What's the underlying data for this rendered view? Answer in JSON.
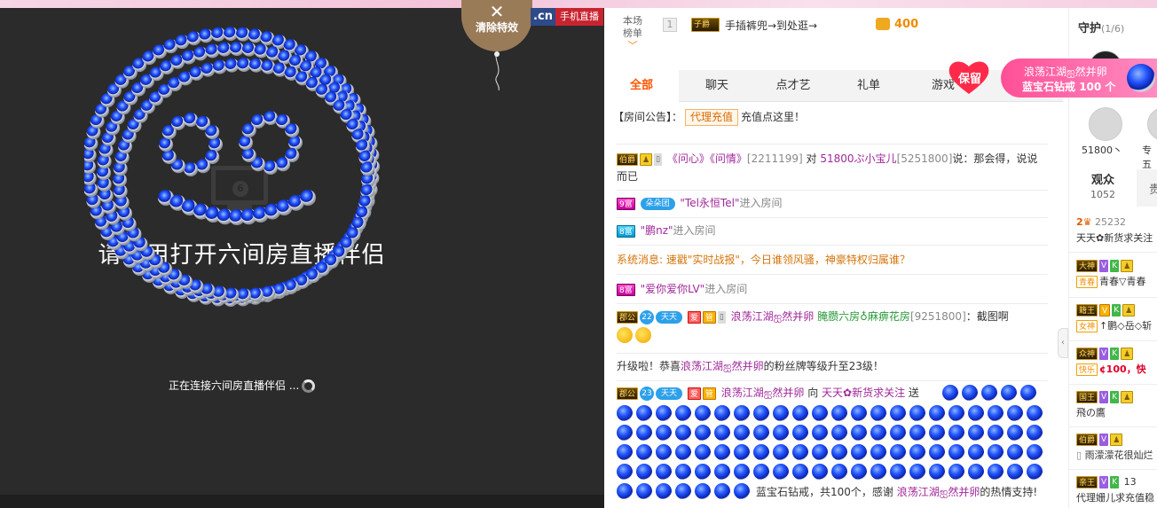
{
  "video": {
    "title": "请使用打开六间房直播伴侣",
    "connecting_text": "正在连接六间房直播伴侣 ...",
    "monitor_badge": "6",
    "clear_effects_label": "清除特效",
    "cn_tag": ".cn",
    "mobile_label": "手机直播"
  },
  "rank": {
    "tab_line1": "本场",
    "tab_line2": "榜单",
    "position": "1",
    "badge": "子爵",
    "user": "手插裤兜→到处逛→",
    "coins": "400"
  },
  "tabs": [
    "全部",
    "聊天",
    "点才艺",
    "礼单",
    "游戏"
  ],
  "notice": {
    "prefix": "【房间公告】：",
    "button": "代理充值",
    "suffix": "充值点这里！"
  },
  "messages": {
    "m1": {
      "badge": "伯爵",
      "user": "《问心》《问情》",
      "uid": "[2211199]",
      "mid": "对",
      "target": "51800ぷ小宝儿",
      "tuid": "[5251800]",
      "text": "说：那会得，说说而已"
    },
    "m2": {
      "badge": "9富",
      "group": "朵朵团",
      "user": "\"Tel永恒Tel\"",
      "text": "进入房间"
    },
    "m3": {
      "badge": "8富",
      "user": "\"鹏nz\"",
      "text": "进入房间"
    },
    "m4": {
      "text": "系统消息: 速戳\"实时战报\"，今日谁领风骚，神豪特权归属谁？"
    },
    "m5": {
      "badge": "郡公",
      "level": "22",
      "group": "天天",
      "b1": "爱",
      "b2": "管",
      "user": "浪荡江湖ஐ然并卵",
      "target": "腌臜六房♁麻痹花房",
      "tuid": "[9251800]",
      "text": "：截图啊"
    },
    "m6": {
      "prefix": "升级啦！恭喜",
      "user": "浪荡江湖ஐ然并卵",
      "suffix": "的粉丝牌等级升至23级！"
    },
    "m7": {
      "badge": "郡公",
      "level": "23",
      "group": "天天",
      "b1": "爱",
      "b2": "管",
      "user": "浪荡江湖ஐ然并卵",
      "mid": "向",
      "target": "天天✿新货求关注",
      "mid2": "送",
      "gift": "蓝宝石钻戒，共100个，感谢",
      "thanks_user": "浪荡江湖ஐ然并卵",
      "thanks": "的热情支持!"
    }
  },
  "protect_label": "保留",
  "gift_banner": {
    "line1": "浪荡江湖ஐ然并卵",
    "line2_prefix": "蓝宝石钻戒",
    "line2_count": "100 个"
  },
  "guard": {
    "title": "守护",
    "count": "(1/6)",
    "name1": "51800丶",
    "name2": "专五",
    "audience_label": "观众",
    "audience_count": "1052",
    "audience_other": "贵"
  },
  "audience": {
    "r1_score": "25232",
    "r1_name": "天天✿新货求关注",
    "r2_badge": "大神",
    "r2_name": "青春",
    "r2_text": "青春▽青春",
    "r3_badge": "女神",
    "r3_name": "↑鹏◇岳◇斩",
    "r4_badge": "快乐",
    "r4_text": "¢100，快",
    "r5_name": "飛の鷹",
    "r6_name": "雨濛濛花很灿烂",
    "r7_num": "13",
    "r7_name": "代理姗儿求充值稳"
  },
  "colors": {
    "accent": "#ff5500",
    "gem_blue": "#2356ff",
    "video_bg": "#2b2b2b",
    "balloon": "#9a7b58"
  }
}
